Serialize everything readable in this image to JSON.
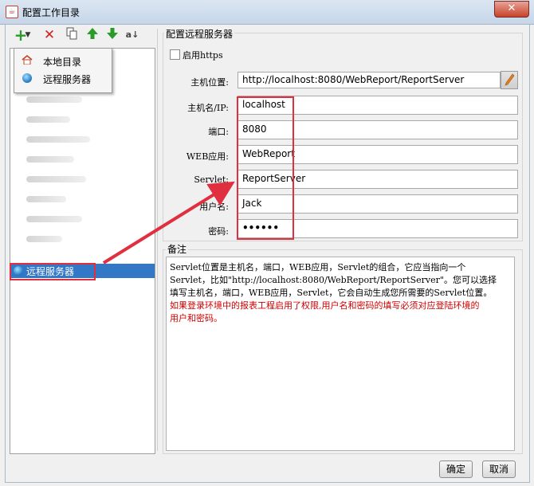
{
  "window": {
    "title": "配置工作目录",
    "close_glyph": "✕",
    "app_icon": "java-icon"
  },
  "toolbar": {
    "icons": [
      "add-icon",
      "dropdown-arrow-icon",
      "delete-icon",
      "copy-icon",
      "move-up-icon",
      "move-down-icon",
      "sort-icon"
    ]
  },
  "popup_menu": {
    "items": [
      {
        "label": "本地目录",
        "icon": "home-icon"
      },
      {
        "label": "远程服务器",
        "icon": "globe-icon"
      }
    ]
  },
  "tree": {
    "selected_item": {
      "label": "远程服务器",
      "icon": "globe-icon"
    },
    "selected_color": "#3377c7"
  },
  "server_config": {
    "group_title": "配置远程服务器",
    "https_label": "启用https",
    "https_checked": false,
    "fields": {
      "host_location": {
        "label": "主机位置:",
        "value": "http://localhost:8080/WebReport/ReportServer"
      },
      "host_ip": {
        "label": "主机名/IP:",
        "value": "localhost"
      },
      "port": {
        "label": "端口:",
        "value": "8080"
      },
      "web_app": {
        "label": "WEB应用:",
        "value": "WebReport"
      },
      "servlet": {
        "label": "Servlet:",
        "value": "ReportServer"
      },
      "username": {
        "label": "用户名:",
        "value": "Jack"
      },
      "password": {
        "label": "密码:",
        "value": "••••••"
      }
    }
  },
  "note": {
    "title": "备注",
    "line1": "Servlet位置是主机名，端口，WEB应用，Servlet的组合，它应当指向一个",
    "line2": "Servlet，比如\"http://localhost:8080/WebReport/ReportServer\"。您可以选择",
    "line3": "填写主机名，端口，WEB应用，Servlet，它会自动生成您所需要的Servlet位置。",
    "red_line1": "如果登录环境中的报表工程启用了权限,用户名和密码的填写必须对应登陆环境的",
    "red_line2": "用户和密码。"
  },
  "buttons": {
    "ok": "确定",
    "cancel": "取消"
  },
  "colors": {
    "annotation_red": "#e03040",
    "note_warning": "#d00000"
  }
}
